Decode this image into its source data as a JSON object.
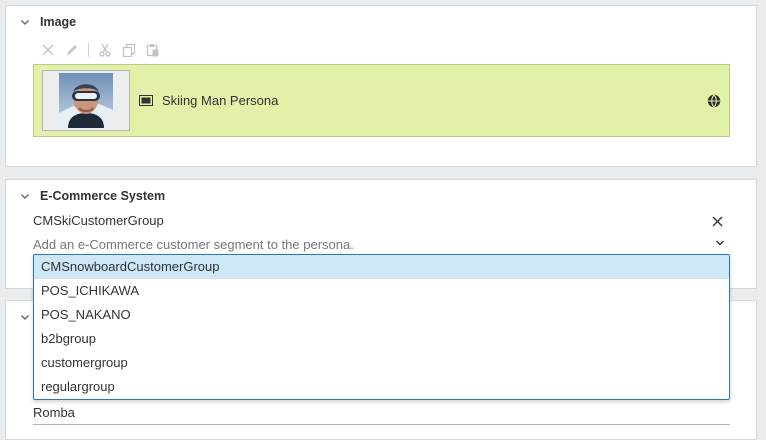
{
  "image_panel": {
    "title": "Image",
    "toolbar": [
      "close-icon",
      "pencil-icon",
      "scissors-icon",
      "copy-icon",
      "paste-icon"
    ],
    "item": {
      "name": "Skiing Man Persona",
      "type_icon": "picture-type-icon",
      "status_icon": "globe-icon"
    }
  },
  "ecommerce_panel": {
    "title": "E-Commerce System",
    "value": "CMSkiCustomerGroup",
    "placeholder": "Add an e-Commerce customer segment to the persona."
  },
  "dropdown": {
    "options": [
      "CMSnowboardCustomerGroup",
      "POS_ICHIKAWA",
      "POS_NAKANO",
      "b2bgroup",
      "customergroup",
      "regulargroup"
    ],
    "selected_index": 0
  },
  "third_panel": {
    "value": "Romba"
  },
  "colors": {
    "selected_item_bg": "#e2f1a8",
    "dropdown_border": "#2c78b5",
    "dropdown_selected": "#cde7f7"
  }
}
